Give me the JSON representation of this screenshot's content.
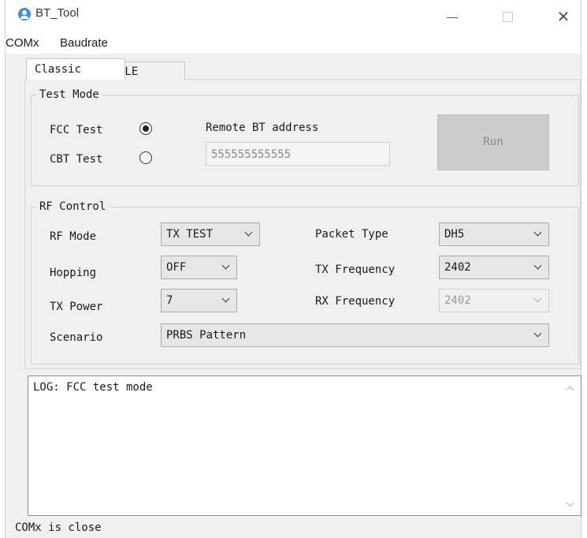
{
  "window": {
    "title": "BT_Tool",
    "close_glyph": "✕",
    "icons": [
      "app-icon",
      "minimize-icon",
      "maximize-icon",
      "close-icon"
    ]
  },
  "menu": {
    "comx": "COMx",
    "baudrate": "Baudrate"
  },
  "tabs": {
    "classic": "Classic",
    "ble": "BLE",
    "selected": "Classic"
  },
  "test_mode": {
    "legend": "Test Mode",
    "fcc_label": "FCC Test",
    "cbt_label": "CBT Test",
    "selected": "FCC Test",
    "remote_label": "Remote BT address",
    "remote_value": "555555555555",
    "run_label": "Run"
  },
  "rf_control": {
    "legend": "RF Control",
    "rf_mode_label": "RF Mode",
    "rf_mode_value": "TX TEST",
    "hopping_label": "Hopping",
    "hopping_value": "OFF",
    "tx_power_label": "TX Power",
    "tx_power_value": "7",
    "scenario_label": "Scenario",
    "scenario_value": "PRBS Pattern",
    "packet_type_label": "Packet Type",
    "packet_type_value": "DH5",
    "tx_freq_label": "TX Frequency",
    "tx_freq_value": "2402",
    "rx_freq_label": "RX Frequency",
    "rx_freq_value": "2402"
  },
  "log": {
    "text": "LOG: FCC test mode"
  },
  "status": {
    "text": "COMx is close"
  },
  "colors": {
    "window_bg": "#f0f0f0",
    "titlebar_bg": "#ffffff",
    "app_icon": "#3b8fe0",
    "disabled_button": "#cccccc"
  }
}
